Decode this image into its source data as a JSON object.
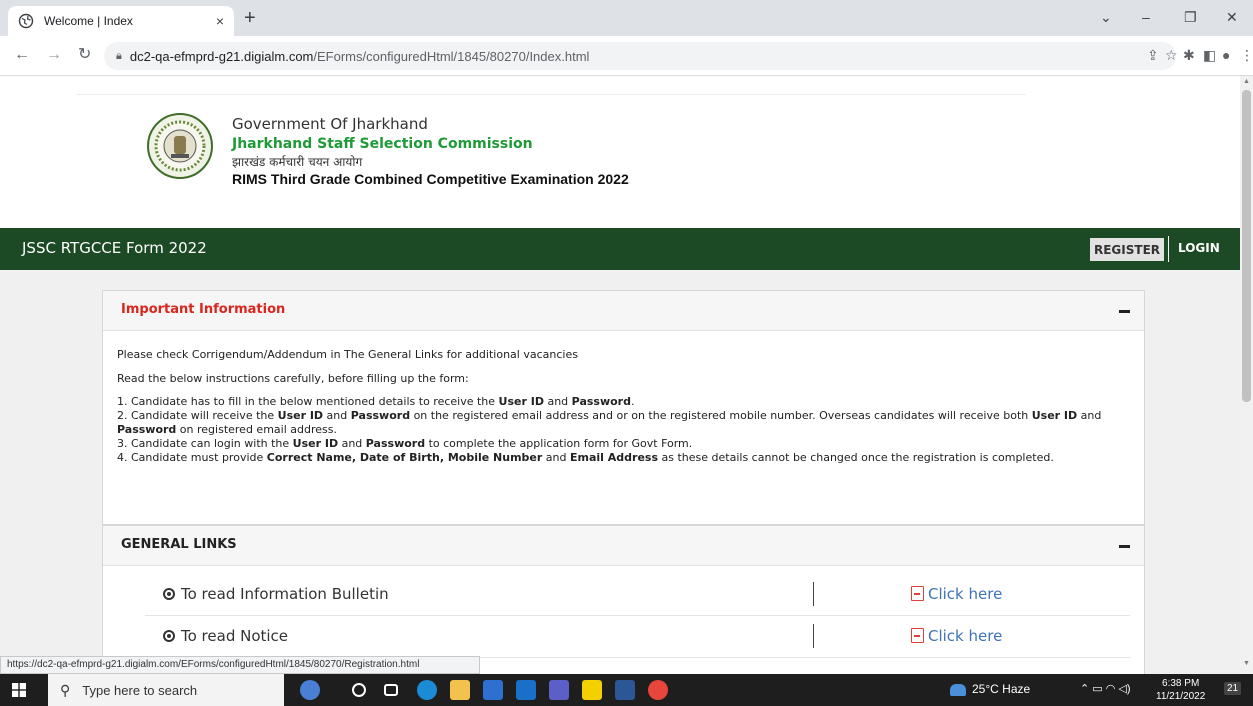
{
  "browser": {
    "tab_title": "Welcome | Index",
    "tab_close": "×",
    "new_tab": "+",
    "min": "–",
    "max": "❐",
    "close": "✕",
    "chevron": "⌄",
    "url_host": "dc2-qa-efmprd-g21.digialm.com",
    "url_path": "/EForms/configuredHtml/1845/80270/Index.html",
    "status_url": "https://dc2-qa-efmprd-g21.digialm.com/EForms/configuredHtml/1845/80270/Registration.html"
  },
  "header": {
    "government": "Government Of Jharkhand",
    "commission": "Jharkhand Staff Selection Commission",
    "commission_hindi": "झारखंड कर्मचारी चयन आयोग",
    "exam": "RIMS Third Grade Combined Competitive Examination 2022"
  },
  "navbar": {
    "brand": "JSSC RTGCCE Form 2022",
    "register": "REGISTER",
    "login": "LOGIN"
  },
  "important": {
    "title": "Important Information",
    "line1": "Please check Corrigendum/Addendum in The General Links for additional vacancies",
    "line2": "Read the below instructions carefully, before filling up the form:",
    "i1_a": "1. Candidate has to fill in the below mentioned details to receive the ",
    "i1_b": "User ID",
    "i1_c": " and ",
    "i1_d": "Password",
    "i1_e": ".",
    "i2_a": "2. Candidate will receive the ",
    "i2_b": "User ID",
    "i2_c": " and ",
    "i2_d": "Password",
    "i2_e": " on the registered email address and or on the registered mobile number. Overseas candidates will receive both ",
    "i2_f": "User ID",
    "i2_g": " and ",
    "i2_h": "Password",
    "i2_i": " on registered email address.",
    "i3_a": "3. Candidate can login with the ",
    "i3_b": "User ID",
    "i3_c": " and ",
    "i3_d": "Password",
    "i3_e": " to complete the application form for Govt Form.",
    "i4_a": "4. Candidate must provide ",
    "i4_b": "Correct Name, Date of Birth, Mobile Number",
    "i4_c": " and ",
    "i4_d": "Email Address",
    "i4_e": " as these details cannot be changed once the registration is completed."
  },
  "general_links": {
    "title": "GENERAL LINKS",
    "rows": [
      {
        "label": "To read Information Bulletin",
        "link": "Click here"
      },
      {
        "label": "To read Notice",
        "link": "Click here"
      }
    ]
  },
  "taskbar": {
    "search_placeholder": "Type here to search",
    "weather": "25°C  Haze",
    "time": "6:38 PM",
    "date": "11/21/2022",
    "notif_count": "21"
  }
}
